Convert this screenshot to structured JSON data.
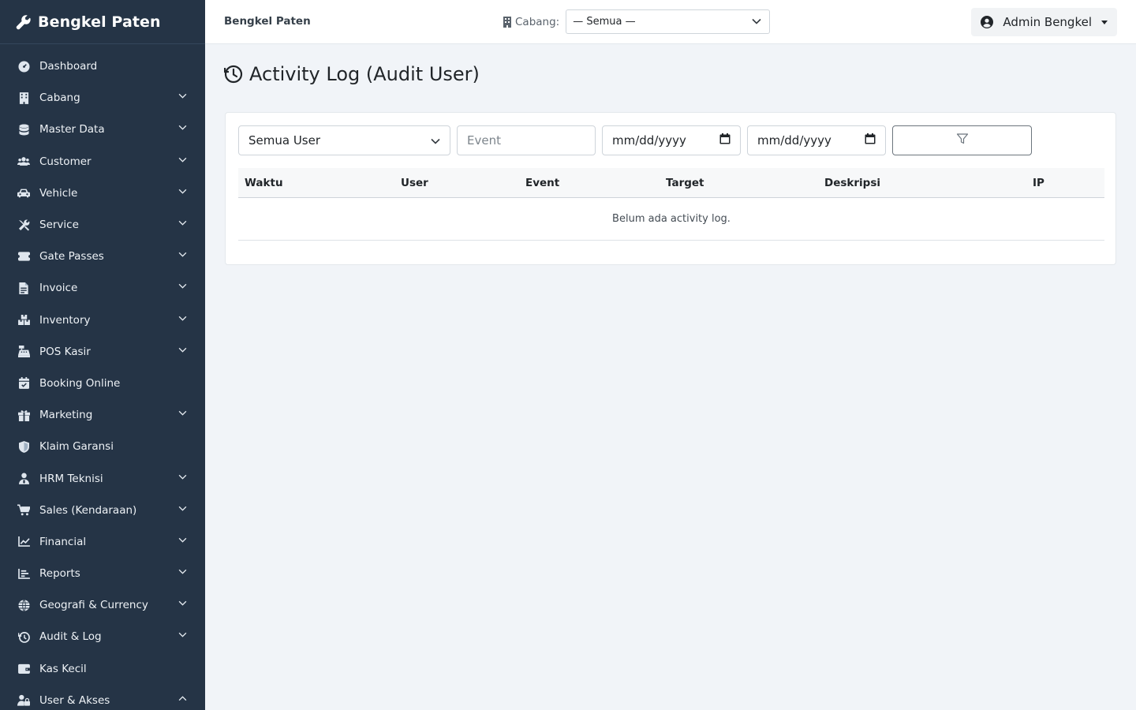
{
  "sidebar": {
    "brand": "Bengkel Paten",
    "items": [
      {
        "label": "Dashboard",
        "icon": "gauge-icon",
        "expandable": false
      },
      {
        "label": "Cabang",
        "icon": "building-icon",
        "expandable": true
      },
      {
        "label": "Master Data",
        "icon": "database-icon",
        "expandable": true
      },
      {
        "label": "Customer",
        "icon": "users-icon",
        "expandable": true
      },
      {
        "label": "Vehicle",
        "icon": "car-icon",
        "expandable": true
      },
      {
        "label": "Service",
        "icon": "tools-icon",
        "expandable": true
      },
      {
        "label": "Gate Passes",
        "icon": "ticket-icon",
        "expandable": true
      },
      {
        "label": "Invoice",
        "icon": "file-invoice-icon",
        "expandable": true
      },
      {
        "label": "Inventory",
        "icon": "boxes-icon",
        "expandable": true
      },
      {
        "label": "POS Kasir",
        "icon": "cash-register-icon",
        "expandable": true
      },
      {
        "label": "Booking Online",
        "icon": "calendar-check-icon",
        "expandable": false
      },
      {
        "label": "Marketing",
        "icon": "gift-icon",
        "expandable": true
      },
      {
        "label": "Klaim Garansi",
        "icon": "shield-icon",
        "expandable": false
      },
      {
        "label": "HRM Teknisi",
        "icon": "user-tie-icon",
        "expandable": true
      },
      {
        "label": "Sales (Kendaraan)",
        "icon": "cart-icon",
        "expandable": true
      },
      {
        "label": "Financial",
        "icon": "chart-line-icon",
        "expandable": true
      },
      {
        "label": "Reports",
        "icon": "chart-bar-icon",
        "expandable": true
      },
      {
        "label": "Geografi & Currency",
        "icon": "globe-icon",
        "expandable": true
      },
      {
        "label": "Audit & Log",
        "icon": "history-icon",
        "expandable": true
      },
      {
        "label": "Kas Kecil",
        "icon": "wallet-icon",
        "expandable": false
      },
      {
        "label": "User & Akses",
        "icon": "user-lock-icon",
        "expandable": true,
        "expanded": true
      }
    ]
  },
  "topbar": {
    "brand": "Bengkel Paten",
    "branch_label": "Cabang:",
    "branch_value": "— Semua —",
    "user_name": "Admin Bengkel"
  },
  "page": {
    "title": "Activity Log (Audit User)"
  },
  "filters": {
    "user_select": "Semua User",
    "event_placeholder": "Event",
    "date_from": "mm/dd/yyyy",
    "date_to": "mm/dd/yyyy"
  },
  "table": {
    "columns": [
      "Waktu",
      "User",
      "Event",
      "Target",
      "Deskripsi",
      "IP"
    ],
    "empty_message": "Belum ada activity log."
  },
  "colors": {
    "sidebar_bg": "#253446",
    "page_bg": "#f1f4f8"
  }
}
